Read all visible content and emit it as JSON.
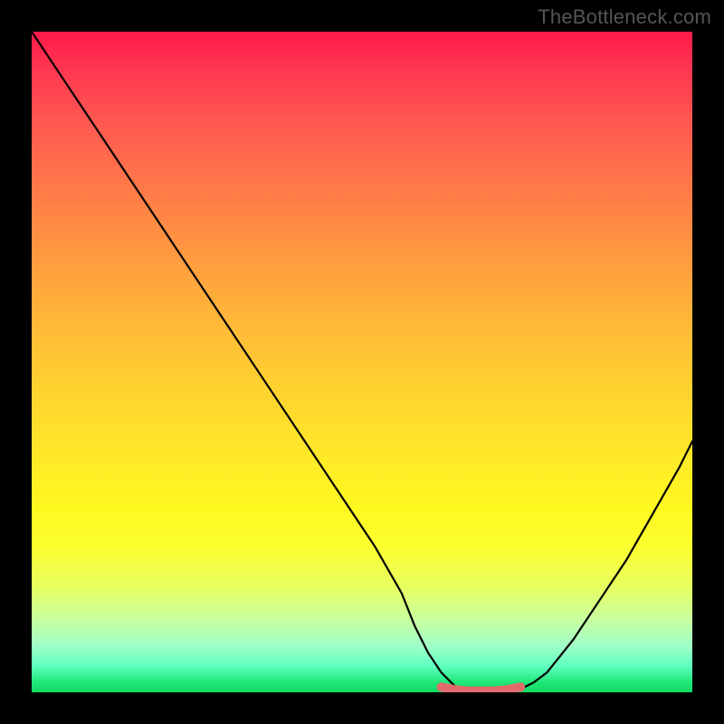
{
  "watermark": "TheBottleneck.com",
  "chart_data": {
    "type": "line",
    "title": "",
    "xlabel": "",
    "ylabel": "",
    "ylim": [
      0,
      100
    ],
    "xlim": [
      0,
      100
    ],
    "series": [
      {
        "name": "bottleneck-curve",
        "x": [
          0,
          4,
          8,
          12,
          16,
          20,
          24,
          28,
          32,
          36,
          40,
          44,
          48,
          52,
          56,
          58,
          60,
          62,
          64,
          66,
          68,
          70,
          72,
          74,
          76,
          78,
          82,
          86,
          90,
          94,
          98,
          100
        ],
        "values": [
          100,
          94,
          88,
          82,
          76,
          70,
          64,
          58,
          52,
          46,
          40,
          34,
          28,
          22,
          15,
          10,
          6,
          3,
          1,
          0,
          0,
          0,
          0,
          0.5,
          1.5,
          3,
          8,
          14,
          20,
          27,
          34,
          38
        ]
      },
      {
        "name": "optimal-range-marker",
        "x": [
          62,
          64,
          66,
          68,
          70,
          72,
          74
        ],
        "values": [
          0.8,
          0.4,
          0.2,
          0.2,
          0.2,
          0.4,
          0.8
        ]
      }
    ],
    "colors": {
      "curve": "#000000",
      "marker": "#e26a6a",
      "gradient_top": "#ff1a4a",
      "gradient_bottom": "#10d860"
    }
  }
}
